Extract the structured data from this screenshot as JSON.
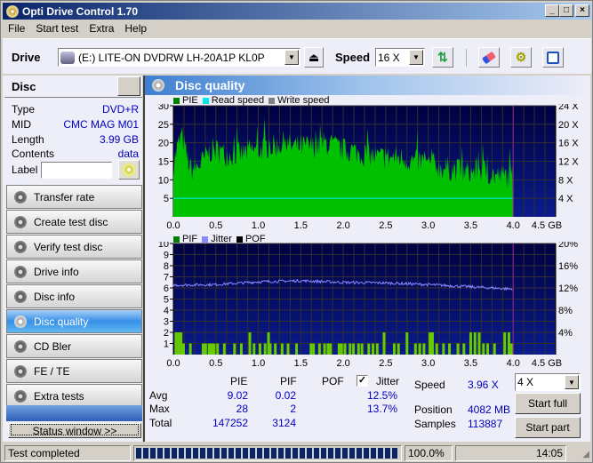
{
  "window": {
    "title": "Opti Drive Control 1.70",
    "controls": [
      "_",
      "□",
      "×"
    ]
  },
  "menu": [
    "File",
    "Start test",
    "Extra",
    "Help"
  ],
  "toolbar": {
    "drive_label": "Drive",
    "drive_value": "(E:)  LITE-ON DVDRW LH-20A1P KL0P",
    "speed_label": "Speed",
    "speed_value": "16 X",
    "icons": [
      "eject-icon",
      "refresh-icon",
      "erase-icon",
      "settings-icon",
      "save-icon"
    ]
  },
  "disc": {
    "header": "Disc",
    "rows": [
      {
        "label": "Type",
        "value": "DVD+R"
      },
      {
        "label": "MID",
        "value": "CMC MAG M01"
      },
      {
        "label": "Length",
        "value": "3.99 GB"
      },
      {
        "label": "Contents",
        "value": "data"
      }
    ],
    "label_field": {
      "label": "Label",
      "value": ""
    }
  },
  "nav": [
    {
      "label": "Transfer rate",
      "active": false
    },
    {
      "label": "Create test disc",
      "active": false
    },
    {
      "label": "Verify test disc",
      "active": false
    },
    {
      "label": "Drive info",
      "active": false
    },
    {
      "label": "Disc info",
      "active": false
    },
    {
      "label": "Disc quality",
      "active": true
    },
    {
      "label": "CD Bler",
      "active": false
    },
    {
      "label": "FE / TE",
      "active": false
    },
    {
      "label": "Extra tests",
      "active": false
    }
  ],
  "status_window_button": "Status window >>",
  "panel_title": "Disc quality",
  "colors": {
    "pie": "#00c000",
    "read_speed": "#00e8e8",
    "write_speed": "#808080",
    "pif": "#66cc00",
    "jitter": "#8888ff",
    "pof": "#000000",
    "plot_bg_top": "#000040",
    "plot_bg_bottom": "#0a1c8c",
    "marker": "#a0209a"
  },
  "chart_data": [
    {
      "type": "bar",
      "title": "PIE / Read speed",
      "legend": [
        "PIE",
        "Read speed",
        "Write speed"
      ],
      "xlabel": "GB",
      "x_ticks": [
        "0.0",
        "0.5",
        "1.0",
        "1.5",
        "2.0",
        "2.5",
        "3.0",
        "3.5",
        "4.0",
        "4.5 GB"
      ],
      "xlim": [
        0,
        4.5
      ],
      "ylim": [
        0,
        30
      ],
      "y_ticks": [
        5,
        10,
        15,
        20,
        25,
        30
      ],
      "y2_ticks": [
        "4 X",
        "8 X",
        "12 X",
        "16 X",
        "20 X",
        "24 X"
      ],
      "y2lim": [
        0,
        24
      ],
      "disc_end_gb": 4.0,
      "read_speed_x": 4,
      "pie_profile": [
        [
          0.0,
          14
        ],
        [
          0.05,
          19
        ],
        [
          0.1,
          22
        ],
        [
          0.15,
          17
        ],
        [
          0.2,
          13
        ],
        [
          0.25,
          13
        ],
        [
          0.3,
          14
        ],
        [
          0.35,
          15
        ],
        [
          0.4,
          17
        ],
        [
          0.45,
          18
        ],
        [
          0.5,
          18
        ],
        [
          0.6,
          17
        ],
        [
          0.7,
          17
        ],
        [
          0.8,
          17
        ],
        [
          0.9,
          18
        ],
        [
          1.0,
          18
        ],
        [
          1.1,
          19
        ],
        [
          1.2,
          19
        ],
        [
          1.3,
          20
        ],
        [
          1.4,
          19
        ],
        [
          1.5,
          19
        ],
        [
          1.6,
          19
        ],
        [
          1.7,
          19
        ],
        [
          1.8,
          20
        ],
        [
          1.9,
          19
        ],
        [
          2.0,
          18
        ],
        [
          2.1,
          18
        ],
        [
          2.2,
          17
        ],
        [
          2.3,
          17
        ],
        [
          2.4,
          16
        ],
        [
          2.5,
          16
        ],
        [
          2.6,
          16
        ],
        [
          2.7,
          16
        ],
        [
          2.8,
          15
        ],
        [
          2.9,
          15
        ],
        [
          3.0,
          14
        ],
        [
          3.1,
          14
        ],
        [
          3.2,
          13
        ],
        [
          3.3,
          13
        ],
        [
          3.4,
          12
        ],
        [
          3.5,
          12
        ],
        [
          3.6,
          13
        ],
        [
          3.7,
          12
        ],
        [
          3.8,
          11
        ],
        [
          3.9,
          11
        ],
        [
          3.99,
          11
        ]
      ],
      "pie_max": 28
    },
    {
      "type": "bar",
      "title": "PIF / Jitter",
      "legend": [
        "PIF",
        "Jitter",
        "POF"
      ],
      "xlabel": "GB",
      "x_ticks": [
        "0.0",
        "0.5",
        "1.0",
        "1.5",
        "2.0",
        "2.5",
        "3.0",
        "3.5",
        "4.0",
        "4.5 GB"
      ],
      "xlim": [
        0,
        4.5
      ],
      "ylim": [
        0,
        10
      ],
      "y_ticks": [
        1,
        2,
        3,
        4,
        5,
        6,
        7,
        8,
        9,
        10
      ],
      "y2_ticks": [
        "4%",
        "8%",
        "12%",
        "16%",
        "20%"
      ],
      "y2lim": [
        0,
        20
      ],
      "pif_bars": [
        [
          0.03,
          2
        ],
        [
          0.06,
          2
        ],
        [
          0.09,
          2
        ],
        [
          0.12,
          1
        ],
        [
          0.2,
          1
        ],
        [
          0.35,
          1
        ],
        [
          0.38,
          1
        ],
        [
          0.42,
          1
        ],
        [
          0.45,
          1
        ],
        [
          0.48,
          1
        ],
        [
          0.52,
          1
        ],
        [
          0.6,
          1
        ],
        [
          0.72,
          1
        ],
        [
          0.8,
          1
        ],
        [
          0.9,
          2
        ],
        [
          0.95,
          1
        ],
        [
          1.02,
          1
        ],
        [
          1.08,
          1
        ],
        [
          1.12,
          2
        ],
        [
          1.14,
          1
        ],
        [
          1.2,
          1
        ],
        [
          1.28,
          1
        ],
        [
          1.35,
          1
        ],
        [
          1.45,
          1
        ],
        [
          1.62,
          1
        ],
        [
          1.65,
          1
        ],
        [
          1.72,
          1
        ],
        [
          1.78,
          1
        ],
        [
          1.82,
          1
        ],
        [
          1.85,
          1
        ],
        [
          1.95,
          1
        ],
        [
          1.98,
          1
        ],
        [
          2.02,
          1
        ],
        [
          2.08,
          1
        ],
        [
          2.12,
          1
        ],
        [
          2.18,
          1
        ],
        [
          2.22,
          1
        ],
        [
          2.3,
          1
        ],
        [
          2.35,
          1
        ],
        [
          2.4,
          1
        ],
        [
          2.48,
          2
        ],
        [
          2.6,
          1
        ],
        [
          2.65,
          1
        ],
        [
          2.75,
          2
        ],
        [
          2.85,
          1
        ],
        [
          2.9,
          1
        ],
        [
          2.95,
          1
        ],
        [
          3.02,
          2
        ],
        [
          3.05,
          2
        ],
        [
          3.1,
          1
        ],
        [
          3.18,
          1
        ],
        [
          3.25,
          1
        ],
        [
          3.35,
          1
        ],
        [
          3.42,
          1
        ],
        [
          3.5,
          2
        ],
        [
          3.55,
          2
        ],
        [
          3.6,
          2
        ],
        [
          3.65,
          1
        ],
        [
          3.7,
          1
        ],
        [
          3.78,
          1
        ],
        [
          3.9,
          2
        ],
        [
          3.95,
          2
        ],
        [
          3.98,
          1
        ]
      ],
      "jitter_profile": [
        [
          0.0,
          12.5
        ],
        [
          0.5,
          12.6
        ],
        [
          1.0,
          13.1
        ],
        [
          1.5,
          13.3
        ],
        [
          2.0,
          13.0
        ],
        [
          2.5,
          12.9
        ],
        [
          3.0,
          12.6
        ],
        [
          3.5,
          12.2
        ],
        [
          3.99,
          11.8
        ]
      ]
    }
  ],
  "stats": {
    "columns": [
      "PIE",
      "PIF",
      "POF"
    ],
    "jitter_label": "Jitter",
    "jitter_checked": true,
    "rows": [
      {
        "label": "Avg",
        "pie": "9.02",
        "pif": "0.02",
        "pof": "",
        "jitter": "12.5%"
      },
      {
        "label": "Max",
        "pie": "28",
        "pif": "2",
        "pof": "",
        "jitter": "13.7%"
      },
      {
        "label": "Total",
        "pie": "147252",
        "pif": "3124",
        "pof": "",
        "jitter": ""
      }
    ],
    "speed_label": "Speed",
    "speed_value": "3.96 X",
    "position_label": "Position",
    "position_value": "4082 MB",
    "samples_label": "Samples",
    "samples_value": "113887",
    "speed_select": "4 X",
    "start_full": "Start full",
    "start_part": "Start part"
  },
  "statusbar": {
    "message": "Test completed",
    "progress_percent": 100.0,
    "progress_text": "100.0%",
    "time": "14:05"
  }
}
